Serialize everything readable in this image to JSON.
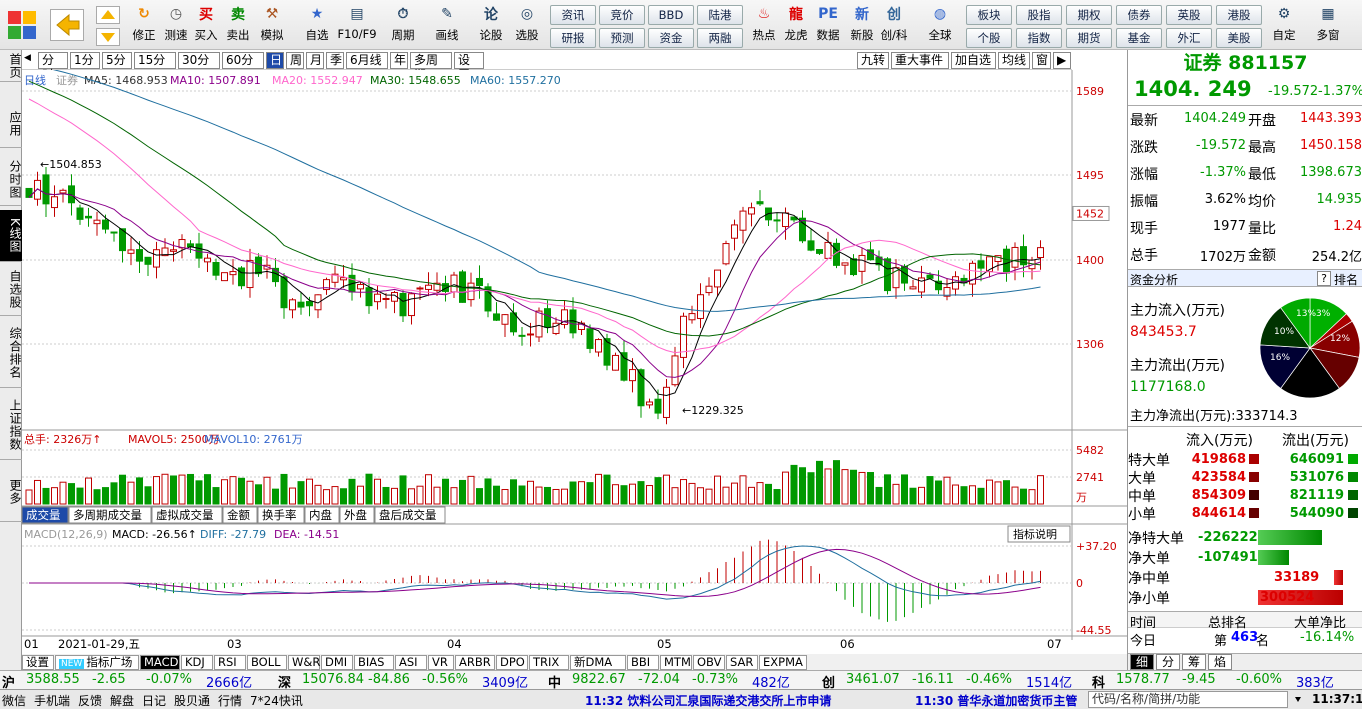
{
  "toolbar": {
    "items": [
      {
        "label": "修正",
        "icon": "refresh-icon"
      },
      {
        "label": "测速",
        "icon": "clock-icon"
      },
      {
        "label": "买入",
        "icon": "buy-icon"
      },
      {
        "label": "卖出",
        "icon": "sell-icon"
      },
      {
        "label": "模拟",
        "icon": "hammer-icon"
      },
      {
        "label": "自选",
        "icon": "star-icon"
      },
      {
        "label": "F10/F9",
        "icon": "f10-icon"
      },
      {
        "label": "周期",
        "icon": "cycle-icon"
      },
      {
        "label": "画线",
        "icon": "pen-icon"
      },
      {
        "label": "论股",
        "icon": "discuss-icon"
      },
      {
        "label": "选股",
        "icon": "select-icon"
      }
    ],
    "grid_buttons": [
      [
        "资讯",
        "研报"
      ],
      [
        "竞价",
        "预测"
      ],
      [
        "BBD",
        "资金"
      ],
      [
        "陆港",
        "两融"
      ]
    ],
    "icon_items": [
      {
        "label": "热点",
        "icon": "hot-icon"
      },
      {
        "label": "龙虎",
        "icon": "dragon-icon"
      },
      {
        "label": "数据",
        "icon": "pe-icon"
      },
      {
        "label": "新股",
        "icon": "new-icon"
      },
      {
        "label": "创/科",
        "icon": "chuang-icon"
      },
      {
        "label": "全球",
        "icon": "globe-icon"
      }
    ],
    "grid_buttons2": [
      [
        "板块",
        "个股"
      ],
      [
        "股指",
        "指数"
      ],
      [
        "期权",
        "期货"
      ],
      [
        "债券",
        "基金"
      ],
      [
        "英股",
        "外汇"
      ],
      [
        "港股",
        "美股"
      ]
    ],
    "right_items": [
      {
        "label": "自定",
        "icon": "custom-icon"
      },
      {
        "label": "多窗",
        "icon": "multiwin-icon"
      }
    ]
  },
  "left_nav": [
    "首页",
    "应用",
    "分时图",
    "K线图",
    "自选股",
    "综合排名",
    "上证指数",
    "更多"
  ],
  "chart_toolbar": {
    "periods": [
      "分时",
      "1分",
      "5分",
      "15分",
      "30分",
      "60分",
      "日",
      "周",
      "月",
      "季",
      "6月线",
      "年",
      "多周期",
      "设置"
    ],
    "active": "日",
    "right": [
      "九转",
      "重大事件",
      "加自选",
      "均线",
      "窗"
    ]
  },
  "price_header": {
    "kline_label": "日线",
    "name": "证券",
    "ma5": "MA5: 1468.953",
    "ma10": "MA10: 1507.891",
    "ma20": "MA20: 1552.947",
    "ma30": "MA30: 1548.655",
    "ma60": "MA60: 1557.270"
  },
  "price_axis": [
    "1589",
    "1495",
    "1452",
    "1400",
    "1306"
  ],
  "annotations": {
    "high": "1504.853",
    "low": "1229.325"
  },
  "volume_header": {
    "total": "总手: 2326万↑",
    "mavol5": "MAVOL5: 2500万",
    "mavol10": "MAVOL10: 2761万"
  },
  "volume_axis": [
    "5482",
    "2741",
    "万"
  ],
  "sub_tabs": [
    "成交量",
    "多周期成交量",
    "虚拟成交量",
    "金额",
    "换手率",
    "内盘",
    "外盘",
    "盘后成交量"
  ],
  "macd_header": {
    "name": "MACD(12,26,9)",
    "macd": "MACD: -26.56↑",
    "diff": "DIFF: -27.79",
    "dea": "DEA: -14.51",
    "explain": "指标说明"
  },
  "macd_axis": [
    "+37.20",
    "0",
    "-44.55"
  ],
  "date_axis": [
    "01",
    "2021-01-29,五",
    "03",
    "04",
    "05",
    "06",
    "07"
  ],
  "indicator_tabs": [
    "设置",
    "指标广场",
    "MACD",
    "KDJ",
    "RSI",
    "BOLL",
    "W&R",
    "DMI",
    "BIAS",
    "ASI",
    "VR",
    "ARBR",
    "DPO",
    "TRIX",
    "新DMA",
    "BBI",
    "MTM",
    "OBV",
    "SAR",
    "EXPMA"
  ],
  "right_panel": {
    "title": "证券 881157",
    "price": "1404. 249",
    "change": "-19.572",
    "pct": "-1.37%",
    "stats": [
      {
        "l1": "最新",
        "v1": "1404.249",
        "l2": "开盘",
        "v2": "1443.393"
      },
      {
        "l1": "涨跌",
        "v1": "-19.572",
        "l2": "最高",
        "v2": "1450.158"
      },
      {
        "l1": "涨幅",
        "v1": "-1.37%",
        "l2": "最低",
        "v2": "1398.673"
      },
      {
        "l1": "振幅",
        "v1": "3.62%",
        "l2": "均价",
        "v2": "14.935"
      },
      {
        "l1": "现手",
        "v1": "1977",
        "l2": "量比",
        "v2": "1.24"
      },
      {
        "l1": "总手",
        "v1": "1702万",
        "l2": "金额",
        "v2": "254.2亿"
      }
    ],
    "fund_title": "资金分析",
    "fund_help": "?",
    "fund_rank": "排名",
    "inflow_label": "主力流入(万元)",
    "inflow": "843453.7",
    "outflow_label": "主力流出(万元)",
    "outflow": "1177168.0",
    "net": "主力净流出(万元):333714.3",
    "pie_labels": [
      "13%",
      "3%",
      "12%",
      "10%",
      "16%"
    ],
    "flow_header": {
      "in": "流入(万元)",
      "out": "流出(万元)"
    },
    "flows": [
      {
        "name": "特大单",
        "in": "419868",
        "out": "646091"
      },
      {
        "name": "大单",
        "in": "423584",
        "out": "531076"
      },
      {
        "name": "中单",
        "in": "854309",
        "out": "821119"
      },
      {
        "name": "小单",
        "in": "844614",
        "out": "544090"
      }
    ],
    "nets": [
      {
        "name": "净特大单",
        "value": "-226222",
        "frac": 0.75
      },
      {
        "name": "净大单",
        "value": "-107491",
        "frac": 0.36
      },
      {
        "name": "净中单",
        "value": "33189",
        "frac": 0.11
      },
      {
        "name": "净小单",
        "value": "300524",
        "frac": 1.0
      }
    ],
    "rank_header": {
      "a": "时间",
      "b": "总排名",
      "c": "大单净比"
    },
    "rank_row": {
      "a": "今日",
      "b": "第",
      "rank": "463",
      "unit": "名",
      "c": "-16.14%"
    },
    "rp_tabs": [
      "细",
      "分",
      "筹",
      "焰"
    ]
  },
  "ticker": [
    {
      "m": "沪",
      "p": "3588.55",
      "c": "-2.65",
      "pct": "-0.07%",
      "v": "2666亿"
    },
    {
      "m": "深",
      "p": "15076.84",
      "c": "-84.86",
      "pct": "-0.56%",
      "v": "3409亿"
    },
    {
      "m": "中",
      "p": "9822.67",
      "c": "-72.04",
      "pct": "-0.73%",
      "v": "482亿"
    },
    {
      "m": "创",
      "p": "3461.07",
      "c": "-16.11",
      "pct": "-0.46%",
      "v": "1514亿"
    },
    {
      "m": "科",
      "p": "1578.77",
      "c": "-9.45",
      "pct": "-0.60%",
      "v": "383亿"
    }
  ],
  "status": {
    "left": [
      "微信",
      "手机端",
      "反馈",
      "解盘",
      "日记",
      "股贝通",
      "行情",
      "7*24快讯"
    ],
    "news1": "11:32 饮料公司汇泉国际递交港交所上市申请",
    "news2": "11:30 普华永道加密货币主管",
    "search": "代码/名称/简拼/功能",
    "time": "11:37:11"
  },
  "colors": {
    "up": "#c00000",
    "down": "#009900",
    "ma5": "#000000",
    "ma10": "#8b008b",
    "ma20": "#ff66cc",
    "ma30": "#006400",
    "ma60": "#1f6f9f"
  }
}
